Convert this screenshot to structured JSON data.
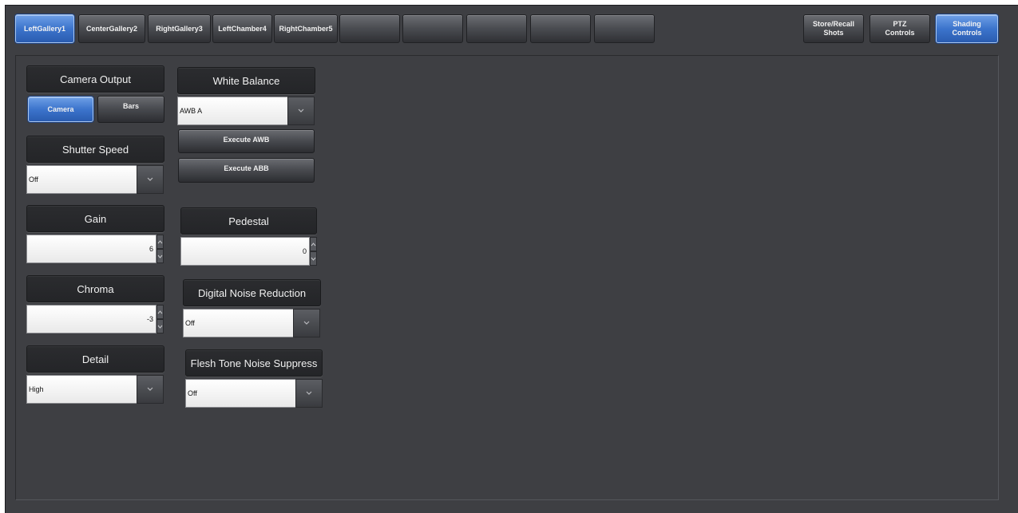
{
  "tabs": [
    {
      "label": "LeftGallery1",
      "active": true
    },
    {
      "label": "CenterGallery2",
      "active": false
    },
    {
      "label": "RightGallery3",
      "active": false
    },
    {
      "label": "LeftChamber4",
      "active": false
    },
    {
      "label": "RightChamber5",
      "active": false
    },
    {
      "label": "",
      "active": false
    },
    {
      "label": "",
      "active": false
    },
    {
      "label": "",
      "active": false
    },
    {
      "label": "",
      "active": false
    },
    {
      "label": "",
      "active": false
    }
  ],
  "right_tabs": {
    "store_recall_line1": "Store/Recall",
    "store_recall_line2": "Shots",
    "ptz_line1": "PTZ",
    "ptz_line2": "Controls",
    "shading_line1": "Shading",
    "shading_line2": "Controls"
  },
  "camera_output": {
    "label": "Camera Output",
    "camera_button": "Camera",
    "bars_button": "Bars",
    "selected": "Camera"
  },
  "white_balance": {
    "label": "White Balance",
    "value": "AWB A",
    "execute_awb": "Execute AWB",
    "execute_abb": "Execute ABB"
  },
  "shutter_speed": {
    "label": "Shutter Speed",
    "value": "Off"
  },
  "gain": {
    "label": "Gain",
    "value": "6"
  },
  "pedestal": {
    "label": "Pedestal",
    "value": "0"
  },
  "chroma": {
    "label": "Chroma",
    "value": "-3"
  },
  "digital_noise_reduction": {
    "label": "Digital Noise Reduction",
    "value": "Off"
  },
  "detail": {
    "label": "Detail",
    "value": "High"
  },
  "flesh_tone": {
    "label": "Flesh Tone Noise Suppress",
    "value": "Off"
  },
  "colors": {
    "background": "#3e3f43",
    "accent_blue": "#3c74cc"
  }
}
